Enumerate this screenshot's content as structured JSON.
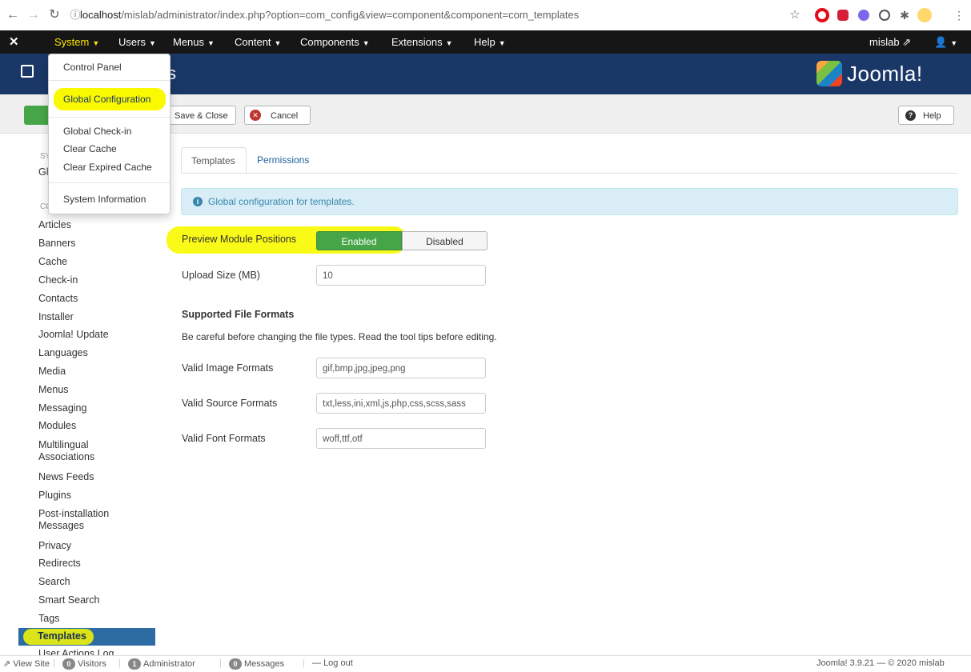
{
  "browser": {
    "url_host": "localhost",
    "url_path": "/mislab/administrator/index.php?option=com_config&view=component&component=com_templates"
  },
  "topmenu": {
    "items": [
      "System",
      "Users",
      "Menus",
      "Content",
      "Components",
      "Extensions",
      "Help"
    ],
    "user": "mislab"
  },
  "header": {
    "title_fragment": "s",
    "brand": "Joomla!"
  },
  "system_menu": {
    "items": [
      "Control Panel",
      "Global Configuration",
      "Global Check-in",
      "Clear Cache",
      "Clear Expired Cache",
      "System Information"
    ]
  },
  "toolbar": {
    "save_close": "Save & Close",
    "cancel": "Cancel",
    "help": "Help"
  },
  "sidebar": {
    "section1_head": "SY",
    "section1_item": "Gl",
    "section2_head": "CO",
    "items": [
      "Articles",
      "Banners",
      "Cache",
      "Check-in",
      "Contacts",
      "Installer",
      "Joomla! Update",
      "Languages",
      "Media",
      "Menus",
      "Messaging",
      "Modules",
      "Multilingual Associations",
      "News Feeds",
      "Plugins",
      "Post-installation Messages",
      "Privacy",
      "Redirects",
      "Search",
      "Smart Search",
      "Tags",
      "Templates",
      "User Actions Log"
    ]
  },
  "tabs": [
    "Templates",
    "Permissions"
  ],
  "info_text": "Global configuration for templates.",
  "form": {
    "preview_label": "Preview Module Positions",
    "enabled": "Enabled",
    "disabled": "Disabled",
    "upload_label": "Upload Size (MB)",
    "upload_value": "10",
    "section_title": "Supported File Formats",
    "section_desc": "Be careful before changing the file types. Read the tool tips before editing.",
    "image_label": "Valid Image Formats",
    "image_value": "gif,bmp,jpg,jpeg,png",
    "source_label": "Valid Source Formats",
    "source_value": "txt,less,ini,xml,js,php,css,scss,sass",
    "font_label": "Valid Font Formats",
    "font_value": "woff,ttf,otf"
  },
  "status": {
    "view_site": "View Site",
    "visitors_count": "0",
    "visitors": "Visitors",
    "admin_count": "1",
    "admin": "Administrator",
    "messages_count": "0",
    "messages": "Messages",
    "logout": "Log out",
    "version": "Joomla! 3.9.21 — © 2020 mislab"
  },
  "colors": {
    "topmenu_bg": "#161616",
    "header_bg": "#1a3867",
    "enabled_green": "#46a546",
    "highlight": "#f9f900",
    "sidebar_active": "#2d6ca2",
    "info_bg": "#d9edf7"
  }
}
